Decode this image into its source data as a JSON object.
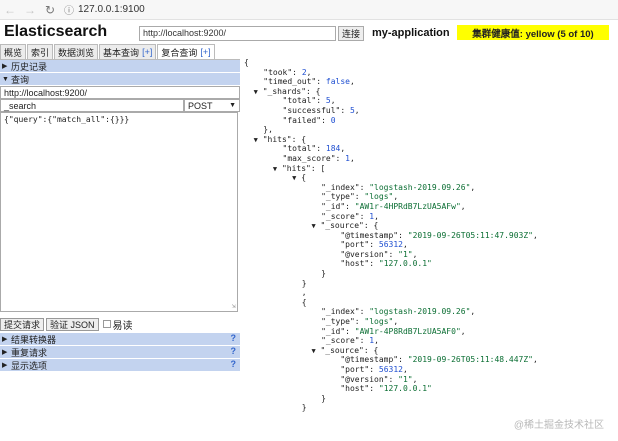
{
  "browser": {
    "url": "127.0.0.1:9100"
  },
  "app": {
    "title": "Elasticsearch",
    "connect_url": "http://localhost:9200/",
    "connect_label": "连接",
    "cluster_name": "my-application",
    "health": "集群健康值: yellow (5 of 10)",
    "health_color": "#ffff00"
  },
  "tabs": [
    {
      "label": "概览",
      "plus": ""
    },
    {
      "label": "索引",
      "plus": ""
    },
    {
      "label": "数据浏览",
      "plus": ""
    },
    {
      "label": "基本查询",
      "plus": "[+]"
    },
    {
      "label": "复合查询",
      "plus": "[+]"
    }
  ],
  "left": {
    "history_label": "历史记录",
    "query_label": "查询",
    "host": "http://localhost:9200/",
    "path": "_search",
    "method": "POST",
    "body": "{\"query\":{\"match_all\":{}}}",
    "submit_label": "提交请求",
    "validate_label": "验证 JSON",
    "pretty_label": "易读",
    "transformer_label": "结果转换器",
    "repeat_label": "重复请求",
    "display_label": "显示选项",
    "help": "?"
  },
  "result": {
    "took": "2",
    "timed_out": "false",
    "shards_total": "5",
    "shards_successful": "5",
    "shards_failed": "0",
    "hits_total": "184",
    "max_score": "1",
    "hit1": {
      "index": "\"logstash-2019.09.26\"",
      "type": "\"logs\"",
      "id": "\"AW1r-4HPRdB7LzUA5AFw\"",
      "score": "1",
      "timestamp": "\"2019-09-26T05:11:47.903Z\"",
      "port": "56312",
      "version": "\"1\"",
      "host": "\"127.0.0.1\""
    },
    "hit2": {
      "index": "\"logstash-2019.09.26\"",
      "type": "\"logs\"",
      "id": "\"AW1r-4P8RdB7LzUA5AF0\"",
      "score": "1",
      "timestamp": "\"2019-09-26T05:11:48.447Z\"",
      "port": "56312",
      "version": "\"1\"",
      "host": "\"127.0.0.1\""
    }
  },
  "watermark": "@稀土掘金技术社区"
}
